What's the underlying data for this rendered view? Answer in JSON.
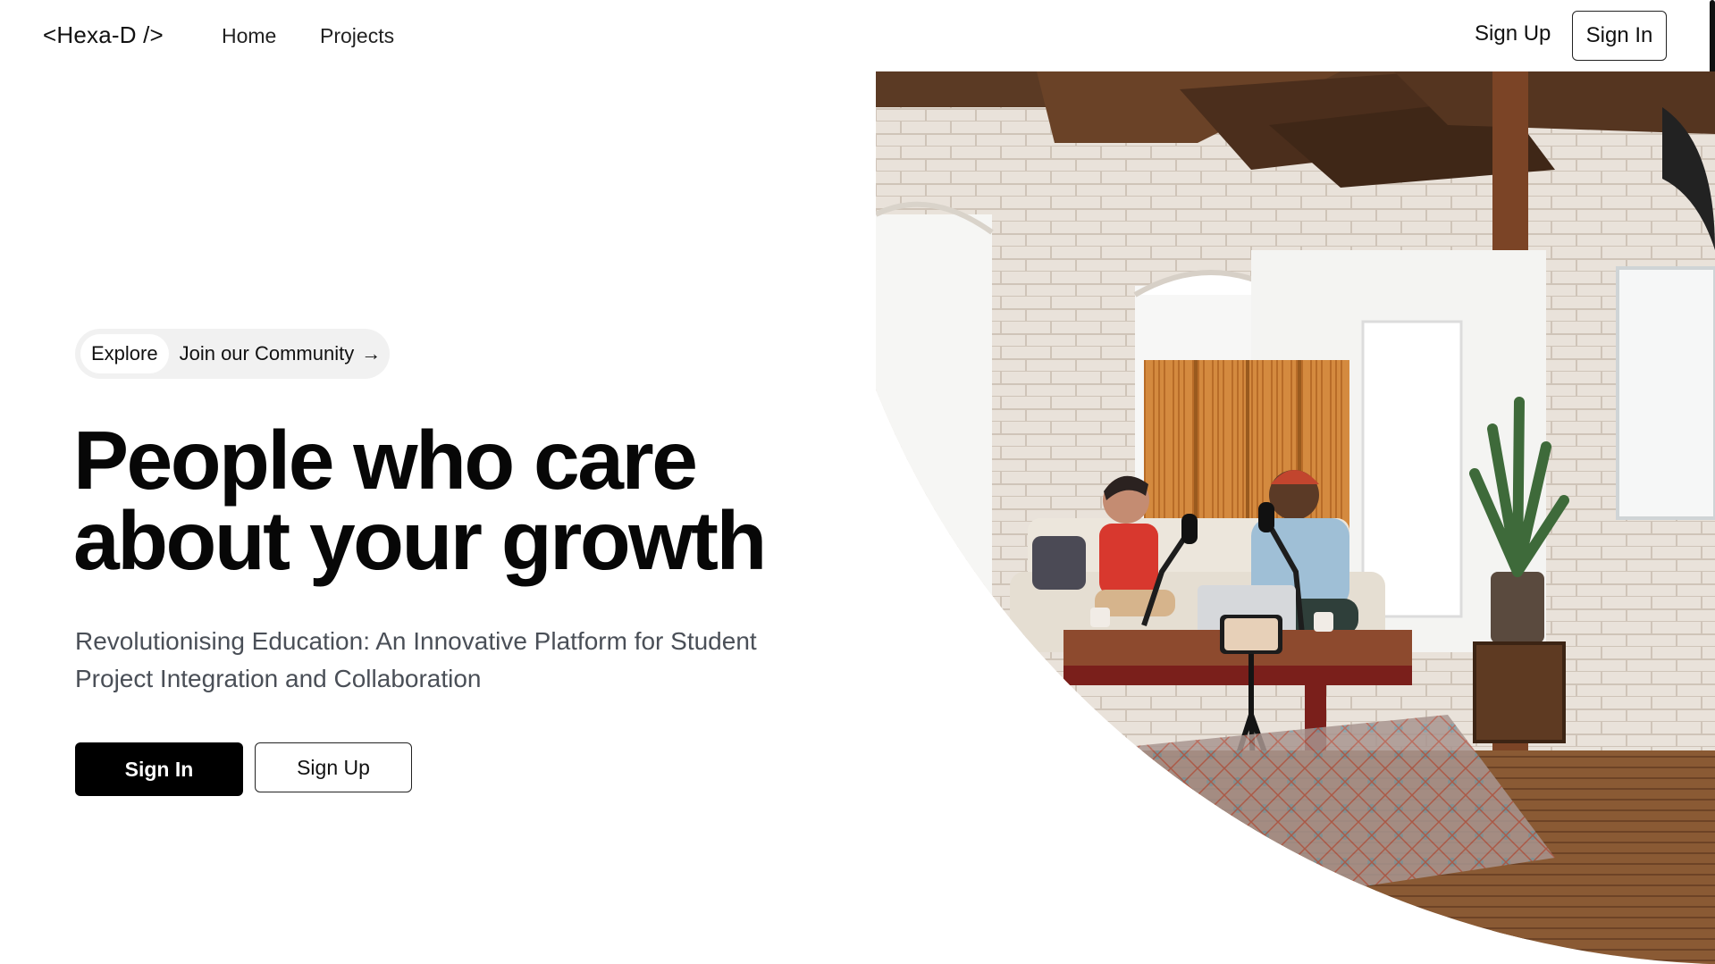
{
  "nav": {
    "logo": "<Hexa-D />",
    "links": [
      {
        "label": "Home"
      },
      {
        "label": "Projects"
      }
    ],
    "signup_label": "Sign Up",
    "signin_label": "Sign In"
  },
  "hero": {
    "pill": {
      "tag": "Explore",
      "link": "Join our Community",
      "arrow": "→"
    },
    "headline_line1": "People who care",
    "headline_line2": "about your growth",
    "subtitle_line1": "Revolutionising Education: An Innovative Platform for Student",
    "subtitle_line2": "Project Integration and Collaboration",
    "signin_button": "Sign In",
    "signup_button": "Sign Up"
  },
  "colors": {
    "primary": "#000000",
    "background": "#ffffff",
    "pill_bg": "#f1f1f1",
    "subtitle": "#4a4f57"
  }
}
